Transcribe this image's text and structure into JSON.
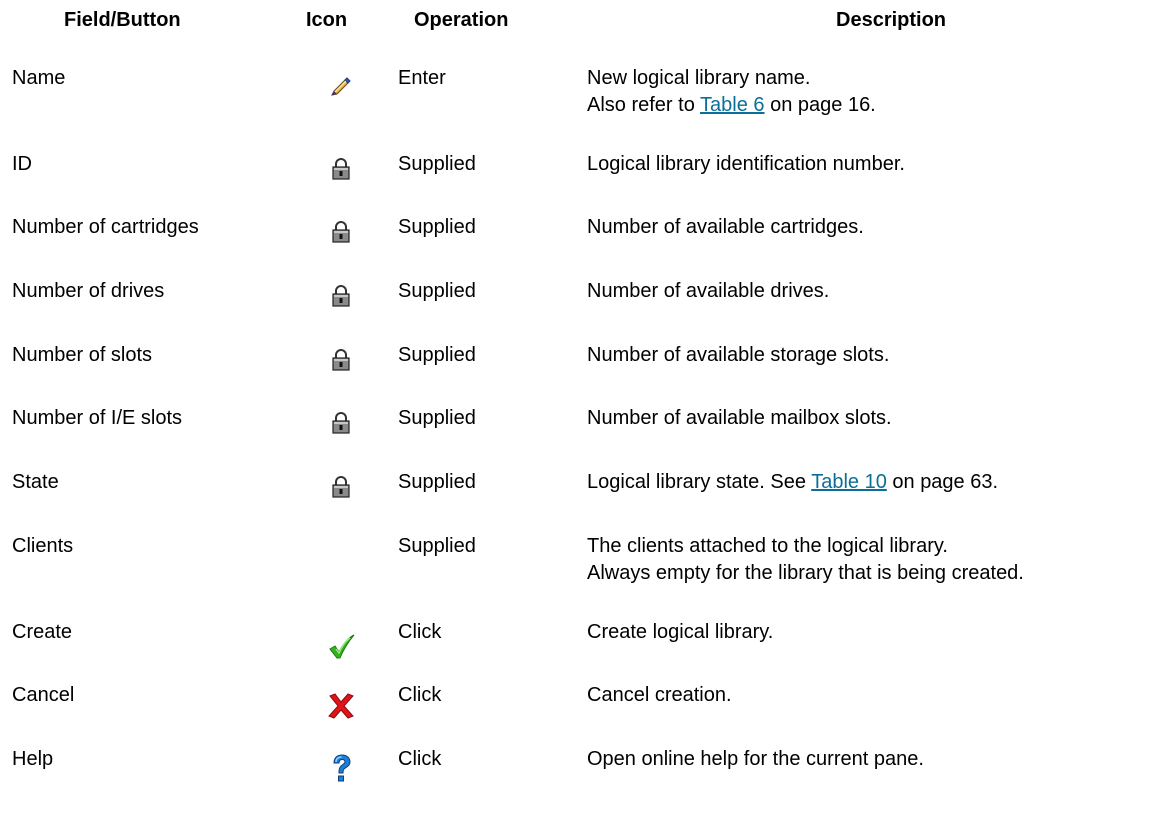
{
  "headers": {
    "field": "Field/Button",
    "icon": "Icon",
    "operation": "Operation",
    "description": "Description"
  },
  "rows": [
    {
      "field": "Name",
      "icon": "pencil-edit-icon",
      "operation": "Enter",
      "desc_line1": "New logical library name.",
      "desc_line2_pre": "Also refer to ",
      "desc_line2_link": "Table 6",
      "desc_line2_post": " on page 16."
    },
    {
      "field": "ID",
      "icon": "lock-icon",
      "operation": "Supplied",
      "desc_line1": "Logical library identification number."
    },
    {
      "field": "Number of cartridges",
      "icon": "lock-icon",
      "operation": "Supplied",
      "desc_line1": "Number of available cartridges."
    },
    {
      "field": "Number of drives",
      "icon": "lock-icon",
      "operation": "Supplied",
      "desc_line1": "Number of available drives."
    },
    {
      "field": "Number of slots",
      "icon": "lock-icon",
      "operation": "Supplied",
      "desc_line1": "Number of available storage slots."
    },
    {
      "field": "Number of I/E slots",
      "icon": "lock-icon",
      "operation": "Supplied",
      "desc_line1": "Number of available mailbox slots."
    },
    {
      "field": "State",
      "icon": "lock-icon",
      "operation": "Supplied",
      "desc_line1_pre": "Logical library state. See ",
      "desc_line1_link": "Table 10",
      "desc_line1_post": " on page 63."
    },
    {
      "field": "Clients",
      "icon": "",
      "operation": "Supplied",
      "desc_line1": "The clients attached to the logical library.",
      "desc_line2": "Always empty for the library that is being created."
    },
    {
      "field": "Create",
      "icon": "checkmark-icon",
      "operation": "Click",
      "desc_line1": "Create logical library."
    },
    {
      "field": "Cancel",
      "icon": "red-x-icon",
      "operation": "Click",
      "desc_line1": "Cancel creation."
    },
    {
      "field": "Help",
      "icon": "question-mark-icon",
      "operation": "Click",
      "desc_line1": "Open online help for the current pane."
    }
  ],
  "colors": {
    "link": "#0b6e99",
    "check": "#2fae1e",
    "cancel": "#e0131a",
    "help": "#1f7fd6"
  }
}
